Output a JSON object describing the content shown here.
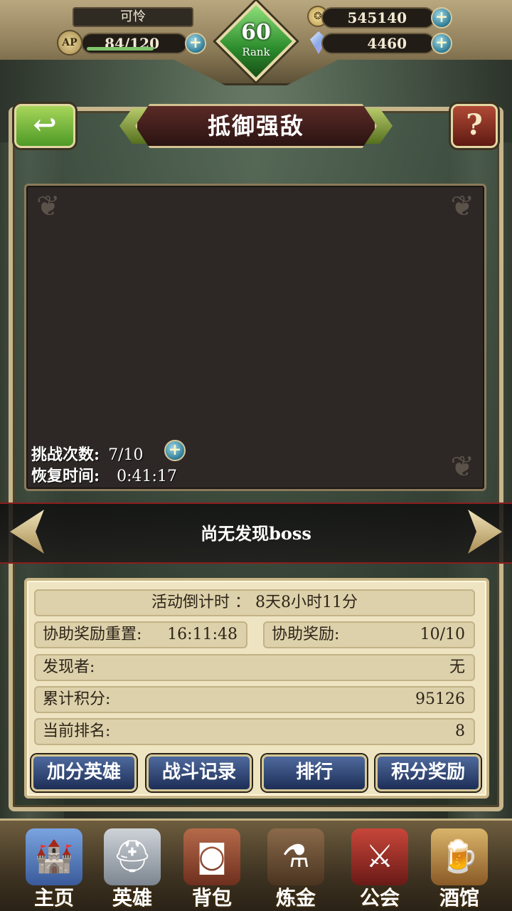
{
  "player": {
    "name": "可怜",
    "ap_label": "AP",
    "ap": "84/120",
    "ap_fill": 0.7,
    "rank_value": "60",
    "rank_label": "Rank",
    "gold": "545140",
    "gems": "4460"
  },
  "header": {
    "title": "抵御强敌",
    "help_label": "?",
    "back_symbol": "↩"
  },
  "boss_panel": {
    "challenges_label": "挑战次数:",
    "challenges_value": "7/10",
    "recover_label": "恢复时间:",
    "recover_value": "0:41:17"
  },
  "boss_status": "尚无发现boss",
  "info": {
    "countdown": "活动倒计时 ： 8天8小时11分",
    "assist_reset_label": "协助奖励重置:",
    "assist_reset_value": "16:11:48",
    "assist_reward_label": "协助奖励:",
    "assist_reward_value": "10/10",
    "finder_label": "发现者:",
    "finder_value": "无",
    "points_label": "累计积分:",
    "points_value": "95126",
    "rank_label": "当前排名:",
    "rank_value": "8"
  },
  "actions": {
    "bonus_heroes": "加分英雄",
    "battle_log": "战斗记录",
    "ranking": "排行",
    "point_rewards": "积分奖励"
  },
  "bottom_nav": [
    {
      "label": "主页",
      "icon": "castle-icon"
    },
    {
      "label": "英雄",
      "icon": "knight-icon"
    },
    {
      "label": "背包",
      "icon": "bag-icon"
    },
    {
      "label": "炼金",
      "icon": "potion-icon"
    },
    {
      "label": "公会",
      "icon": "crest-icon"
    },
    {
      "label": "酒馆",
      "icon": "tavern-icon"
    }
  ],
  "colors": {
    "frame": "#c7b68c",
    "rank_green": "#2c8c2c",
    "button_blue": "#1d2e56",
    "info_bg": "#efe4c2"
  }
}
